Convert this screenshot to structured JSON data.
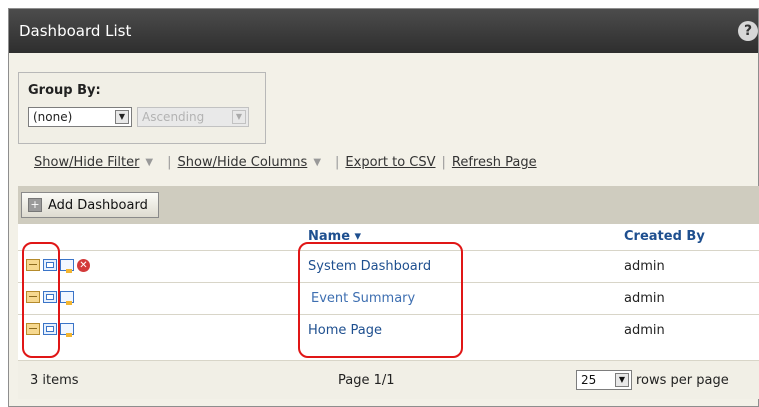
{
  "window": {
    "title": "Dashboard List",
    "help_label": "?"
  },
  "group_by": {
    "label": "Group By:",
    "field_value": "(none)",
    "order_value": "Ascending"
  },
  "links": {
    "show_hide_filter": "Show/Hide Filter",
    "show_hide_columns": "Show/Hide Columns",
    "export_csv": "Export to CSV",
    "refresh_page": "Refresh Page"
  },
  "toolbar": {
    "add_dashboard": "Add Dashboard"
  },
  "table": {
    "columns": {
      "name": "Name ▾",
      "created_by": "Created By"
    },
    "rows": [
      {
        "name": "System Dashboard",
        "created_by": "admin",
        "actions": [
          "edit-icon",
          "copy-icon",
          "message-icon",
          "delete-icon"
        ]
      },
      {
        "name": "Event Summary",
        "created_by": "admin",
        "actions": [
          "edit-icon",
          "copy-icon",
          "message-icon"
        ]
      },
      {
        "name": "Home Page",
        "created_by": "admin",
        "actions": [
          "edit-icon",
          "copy-icon",
          "message-icon"
        ]
      }
    ]
  },
  "footer": {
    "item_count": "3 items",
    "page": "Page 1/1",
    "rows_per_page_value": "25",
    "rows_per_page_label": "rows per page"
  },
  "colors": {
    "titlebar": "#3a3a3a",
    "link_blue": "#1e4f8f",
    "annotation_red": "#e01616"
  }
}
